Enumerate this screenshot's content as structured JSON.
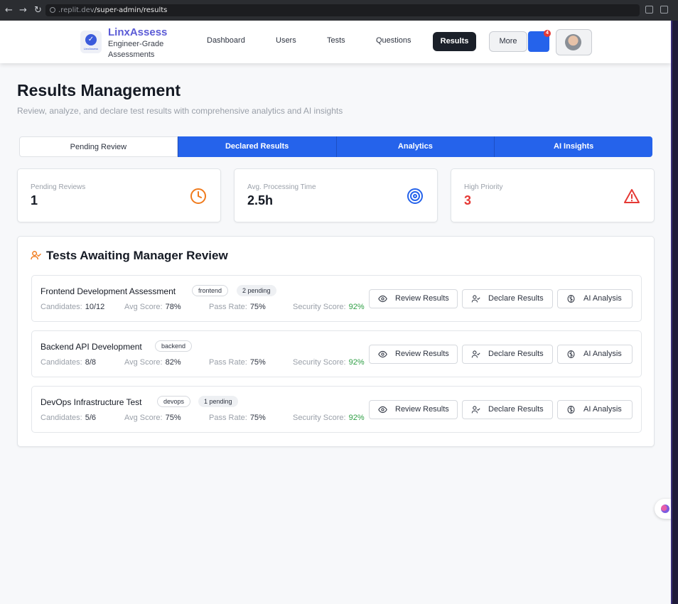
{
  "browser": {
    "url_host": ".replit.dev",
    "url_path": "/super-admin/results"
  },
  "header": {
    "brand_name": "LinxAssess",
    "brand_tagline": "Engineer-Grade Assessments",
    "logo_text": "LinxAssess",
    "nav": {
      "dashboard": "Dashboard",
      "users": "Users",
      "tests": "Tests",
      "questions": "Questions",
      "results": "Results",
      "more": "More"
    },
    "notification_count": "4"
  },
  "page": {
    "title": "Results Management",
    "subtitle": "Review, analyze, and declare test results with comprehensive analytics and AI insights"
  },
  "tabs": [
    "Pending Review",
    "Declared Results",
    "Analytics",
    "AI Insights"
  ],
  "stats": [
    {
      "label": "Pending Reviews",
      "value": "1",
      "icon": "clock-icon",
      "color": "#f07b1d"
    },
    {
      "label": "Avg. Processing Time",
      "value": "2.5h",
      "icon": "target-icon",
      "color": "#2563eb"
    },
    {
      "label": "High Priority",
      "value": "3",
      "icon": "alert-triangle-icon",
      "color": "#e53935"
    }
  ],
  "review": {
    "title": "Tests Awaiting Manager Review",
    "labels": {
      "candidates": "Candidates:",
      "avg_score": "Avg Score:",
      "pass_rate": "Pass Rate:",
      "security_score": "Security Score:"
    },
    "actions": {
      "review": "Review Results",
      "declare": "Declare Results",
      "ai": "AI Analysis"
    },
    "tests": [
      {
        "name": "Frontend Development Assessment",
        "tag": "frontend",
        "pending": "2 pending",
        "candidates": "10/12",
        "avg_score": "78%",
        "pass_rate": "75%",
        "security_score": "92%"
      },
      {
        "name": "Backend API Development",
        "tag": "backend",
        "pending": "",
        "candidates": "8/8",
        "avg_score": "82%",
        "pass_rate": "75%",
        "security_score": "92%"
      },
      {
        "name": "DevOps Infrastructure Test",
        "tag": "devops",
        "pending": "1 pending",
        "candidates": "5/6",
        "avg_score": "75%",
        "pass_rate": "75%",
        "security_score": "92%"
      }
    ]
  },
  "colors": {
    "accent": "#2563eb",
    "brand": "#5b5bd6",
    "success": "#2e9e44",
    "danger": "#e53935",
    "warning": "#f07b1d"
  }
}
